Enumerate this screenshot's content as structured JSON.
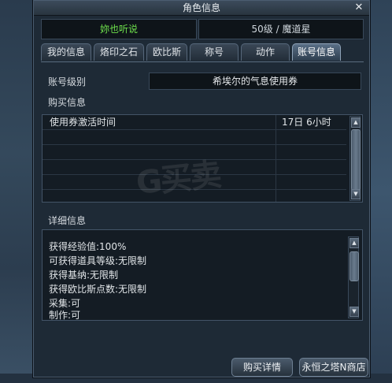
{
  "window": {
    "title": "角色信息",
    "close_label": "✕"
  },
  "character": {
    "name": "妳也听说",
    "level_class": "50级 / 魔道星"
  },
  "tabs": [
    {
      "label": "我的信息",
      "active": false
    },
    {
      "label": "烙印之石",
      "active": false
    },
    {
      "label": "欧比斯",
      "active": false
    },
    {
      "label": "称号",
      "active": false
    },
    {
      "label": "动作",
      "active": false
    },
    {
      "label": "账号信息",
      "active": true
    }
  ],
  "account": {
    "label": "账号级别",
    "value": "希埃尔的气息使用券"
  },
  "purchase": {
    "label": "购买信息",
    "rows": [
      {
        "item": "使用券激活时间",
        "value": "17日 6小时"
      },
      {
        "item": "",
        "value": ""
      },
      {
        "item": "",
        "value": ""
      },
      {
        "item": "",
        "value": ""
      },
      {
        "item": "",
        "value": ""
      },
      {
        "item": "",
        "value": ""
      }
    ],
    "scroll_up": "▲",
    "scroll_down": "▼"
  },
  "detail": {
    "label": "详细信息",
    "lines": [
      "获得经验值:100%",
      "可获得道具等级:无限制",
      "获得基纳:无限制",
      "获得欧比斯点数:无限制",
      "采集:可",
      "制作:可"
    ],
    "scroll_up": "▲",
    "scroll_down": "▼"
  },
  "footer": {
    "purchase_details": "购买详情",
    "shop": "永恒之塔N商店"
  },
  "watermark": "G买卖",
  "colors": {
    "name_green": "#6ee04c",
    "panel_bg": "#1e2a36",
    "field_bg": "#0e1419"
  }
}
